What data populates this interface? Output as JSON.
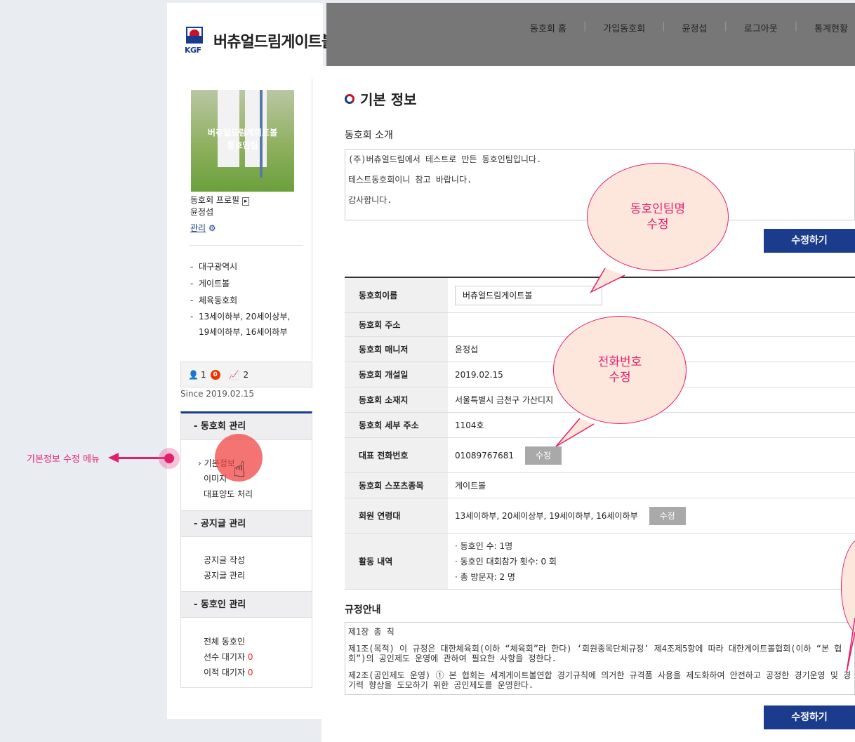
{
  "brand": {
    "name": "버츄얼드림게이트볼",
    "logo_text": "KGF"
  },
  "top_nav": [
    "동호회 홈",
    "가입동호회",
    "윤정섭",
    "로그아웃",
    "통계현황"
  ],
  "profile": {
    "image_caption_1": "버츄얼드림게이트볼",
    "image_caption_2": "동호인팀",
    "profile_link": "동호회 프로필",
    "manager": "윤정섭",
    "manage_link": "관리",
    "tags": [
      "대구광역시",
      "게이트볼",
      "체육동호회",
      "13세이하부, 20세이상부, 19세이하부, 16세이하부"
    ],
    "members": "1",
    "badge": "0",
    "visits": "2",
    "since": "Since 2019.02.15"
  },
  "menu": {
    "club_head": "동호회 관리",
    "club_items": [
      "기본정보",
      "이미지",
      "대표양도 처리"
    ],
    "notice_head": "공지글 관리",
    "notice_items": [
      "공지글 작성",
      "공지글 관리"
    ],
    "member_head": "동호인 관리",
    "member_items": [
      "전체 동호인",
      "선수 대기자",
      "이적 대기자"
    ],
    "player_wait_count": "0",
    "transfer_wait_count": "0"
  },
  "annotation": {
    "left_label": "기본정보 수정 메뉴",
    "bubble_name": "동호인팀명\n수정",
    "bubble_phone": "전화번호\n수정"
  },
  "main": {
    "title": "기본 정보",
    "intro_label": "동호회 소개",
    "intro_lines": [
      "(주)버츄얼드림에서 테스트로 만든 동호인팀입니다.",
      "테스트동호회이니 참고 바랍니다.",
      "감사합니다."
    ],
    "save_label": "수정하기",
    "rows": [
      {
        "th": "동호회이름",
        "td": "버츄얼드림게이트볼"
      },
      {
        "th": "동호회 주소",
        "td": ""
      },
      {
        "th": "동호회 매니저",
        "td": "윤정섭"
      },
      {
        "th": "동호회 개설일",
        "td": "2019.02.15"
      },
      {
        "th": "동호회 소재지",
        "td": "서울특별시 금천구 가산디지"
      },
      {
        "th": "동호회 세부 주소",
        "td": "1104호"
      },
      {
        "th": "대표 전화번호",
        "td": "01089767681"
      },
      {
        "th": "동호회 스포츠종목",
        "td": "게이트볼"
      },
      {
        "th": "회원 연령대",
        "td": "13세이하부, 20세이상부, 19세이하부, 16세이하부"
      },
      {
        "th": "활동 내역",
        "td": ""
      }
    ],
    "edit_label": "수정",
    "activity": [
      "동호인 수: 1명",
      "동호인 대회참가 횟수: 0 회",
      "총 방문자: 2 명"
    ],
    "rule_label": "규정안내",
    "rules": [
      "제1장 총 칙",
      "제1조(목적) 이 규정은 대한체육회(이하 “체육회”라 한다) ‘회원종목단체규정’ 제4조제5항에 따라 대한게이트볼협회(이하 “본 협회”)의 공인제도 운영에 관하여 필요한 사항을 정한다.",
      "제2조(공인제도 운영) ① 본 협회는 세계게이트볼연합 경기규칙에 의거한 규격품 사용을 제도화하여 안전하고 공정한 경기운영 및 경기력 향상을 도모하기 위한 공인제도를 운영한다."
    ]
  }
}
